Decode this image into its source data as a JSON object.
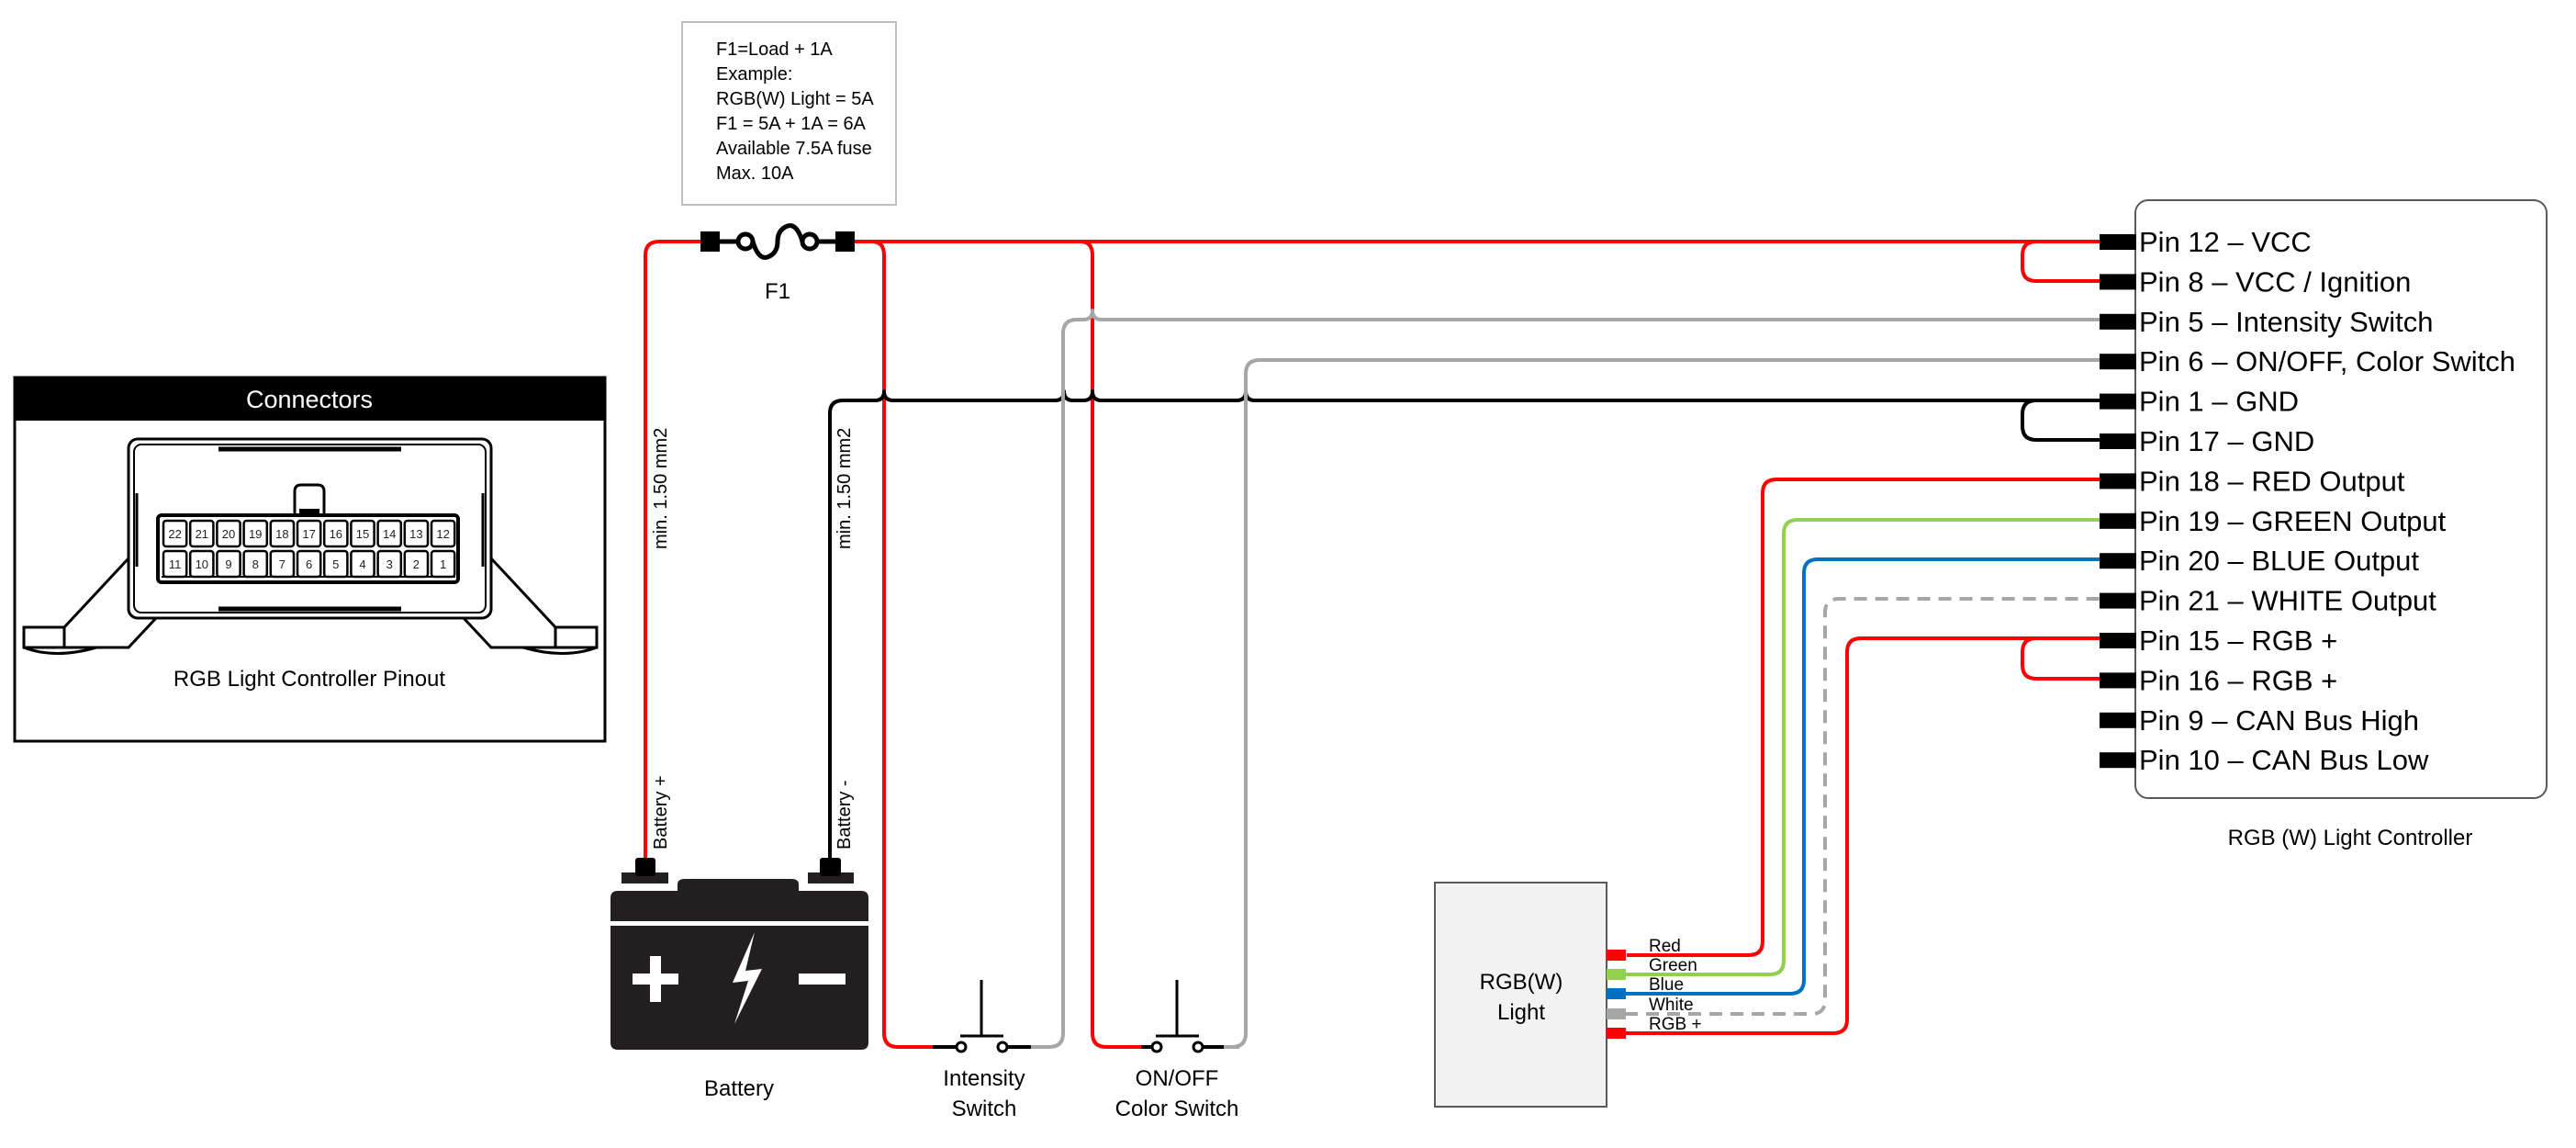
{
  "note": {
    "lines": [
      "F1=Load + 1A",
      "Example:",
      "RGB(W) Light = 5A",
      "F1 = 5A + 1A = 6A",
      "Available 7.5A fuse",
      "Max. 10A"
    ]
  },
  "fuse": {
    "label": "F1"
  },
  "connectors_panel": {
    "title": "Connectors",
    "caption": "RGB Light Controller Pinout",
    "top_row": [
      "22",
      "21",
      "20",
      "19",
      "18",
      "17",
      "16",
      "15",
      "14",
      "13",
      "12"
    ],
    "bottom_row": [
      "11",
      "10",
      "9",
      "8",
      "7",
      "6",
      "5",
      "4",
      "3",
      "2",
      "1"
    ]
  },
  "wire_notes": {
    "positive": "min. 1.50 mm2",
    "negative": "min. 1.50 mm2"
  },
  "battery": {
    "label": "Battery",
    "positive_label": "Battery +",
    "negative_label": "Battery -"
  },
  "switches": [
    {
      "line1": "Intensity",
      "line2": "Switch"
    },
    {
      "line1": "ON/OFF",
      "line2": "Color Switch"
    }
  ],
  "light": {
    "line1": "RGB(W)",
    "line2": "Light",
    "leads": [
      {
        "label": "Red",
        "color": "#ff0000"
      },
      {
        "label": "Green",
        "color": "#92d050"
      },
      {
        "label": "Blue",
        "color": "#0070c0"
      },
      {
        "label": "White",
        "color": "#a6a6a6"
      },
      {
        "label": "RGB +",
        "color": "#ff0000"
      }
    ]
  },
  "controller": {
    "caption": "RGB (W) Light Controller",
    "pins": [
      {
        "label": "Pin 12 – VCC"
      },
      {
        "label": "Pin 8 – VCC / Ignition"
      },
      {
        "label": "Pin 5 – Intensity Switch"
      },
      {
        "label": "Pin 6 – ON/OFF, Color Switch"
      },
      {
        "label": "Pin 1 – GND"
      },
      {
        "label": "Pin 17 – GND"
      },
      {
        "label": "Pin 18 – RED Output"
      },
      {
        "label": "Pin 19 – GREEN Output"
      },
      {
        "label": "Pin 20 – BLUE Output"
      },
      {
        "label": "Pin 21 – WHITE Output"
      },
      {
        "label": "Pin 15 – RGB +"
      },
      {
        "label": "Pin 16 – RGB +"
      },
      {
        "label": "Pin 9 – CAN Bus High"
      },
      {
        "label": "Pin 10 – CAN Bus Low"
      }
    ]
  },
  "colors": {
    "power": "#ff0000",
    "ground": "#000000",
    "switch_wire": "#a6a6a6",
    "green": "#92d050",
    "blue": "#0070c0",
    "white_wire": "#a6a6a6",
    "battery": "#231f20"
  }
}
